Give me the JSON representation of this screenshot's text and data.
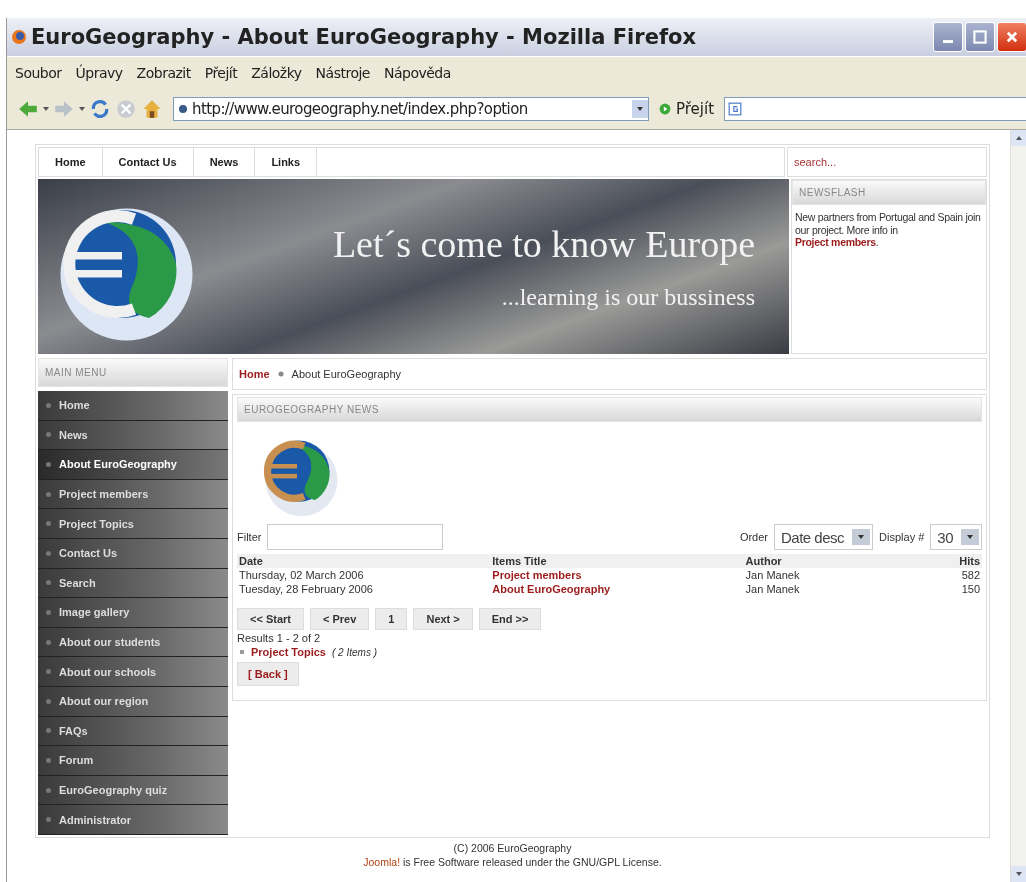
{
  "window": {
    "title": "EuroGeography - About EuroGeography - Mozilla Firefox"
  },
  "menu_bar": [
    "Soubor",
    "Úpravy",
    "Zobrazit",
    "Přejít",
    "Záložky",
    "Nástroje",
    "Nápověda"
  ],
  "toolbar": {
    "address": "http://www.eurogeography.net/index.php?option",
    "go_label": "Přejít"
  },
  "top_nav": [
    "Home",
    "Contact Us",
    "News",
    "Links"
  ],
  "search": {
    "placeholder": "search..."
  },
  "banner": {
    "headline": "Let´s come to know Europe",
    "tagline": "...learning is our bussiness"
  },
  "newsflash": {
    "heading": "NEWSFLASH",
    "text": "New partners from Portugal and Spain join our project. More info in ",
    "link": "Project members",
    "end": "."
  },
  "main_menu": {
    "heading": "MAIN MENU",
    "items": [
      {
        "label": "Home",
        "selected": false
      },
      {
        "label": "News",
        "selected": false
      },
      {
        "label": "About EuroGeography",
        "selected": true
      },
      {
        "label": "Project members",
        "selected": false
      },
      {
        "label": "Project Topics",
        "selected": false
      },
      {
        "label": "Contact Us",
        "selected": false
      },
      {
        "label": "Search",
        "selected": false
      },
      {
        "label": "Image gallery",
        "selected": false
      },
      {
        "label": "About our students",
        "selected": false
      },
      {
        "label": "About our schools",
        "selected": false
      },
      {
        "label": "About our region",
        "selected": false
      },
      {
        "label": "FAQs",
        "selected": false
      },
      {
        "label": "Forum",
        "selected": false
      },
      {
        "label": "EuroGeography quiz",
        "selected": false
      },
      {
        "label": "Administrator",
        "selected": false
      }
    ]
  },
  "breadcrumb": {
    "link": "Home",
    "current": "About EuroGeography"
  },
  "section": {
    "heading": "EUROGEOGRAPHY NEWS"
  },
  "filters": {
    "filter_label": "Filter",
    "order_label": "Order",
    "order_value": "Date desc",
    "display_label": "Display #",
    "display_value": "30"
  },
  "table": {
    "columns": [
      "Date",
      "Items Title",
      "Author",
      "Hits"
    ],
    "rows": [
      [
        "Thursday, 02 March 2006",
        "Project members",
        "Jan Manek",
        "582"
      ],
      [
        "Tuesday, 28 February 2006",
        "About EuroGeography",
        "Jan Manek",
        "150"
      ]
    ]
  },
  "pagination": [
    "<< Start",
    "< Prev",
    "1",
    "Next >",
    "End >>"
  ],
  "results": "Results 1 - 2 of 2",
  "category": {
    "link": "Project Topics",
    "count": "( 2 Items )"
  },
  "back": "[ Back ]",
  "footer": {
    "copyright": "(C) 2006 EuroGeography",
    "link": "Joomla!",
    "license": " is Free Software released under the GNU/GPL License."
  }
}
